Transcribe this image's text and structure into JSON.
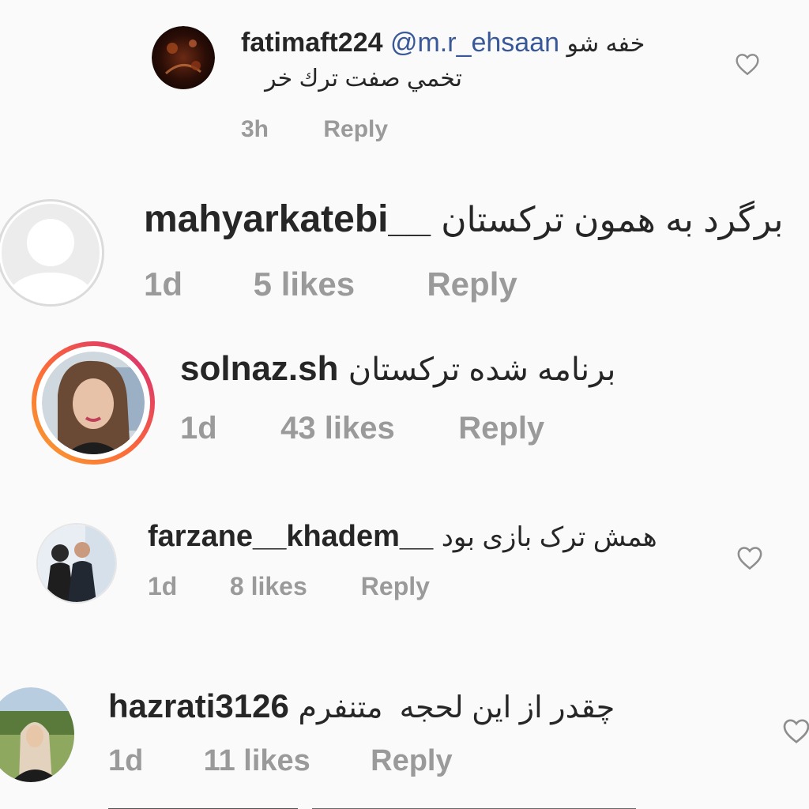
{
  "comments": [
    {
      "username": "fatimaft224",
      "mention": "@m.r_ehsaan",
      "text_line1": "خفه شو",
      "text_line2": "تخمي صفت ترك خر",
      "time": "3h",
      "likes": "",
      "reply": "Reply"
    },
    {
      "username": "mahyarkatebi__",
      "text": "برگرد به همون ترکستان",
      "time": "1d",
      "likes": "5 likes",
      "reply": "Reply"
    },
    {
      "username": "solnaz.sh",
      "text": "برنامه شده ترکستان",
      "time": "1d",
      "likes": "43 likes",
      "reply": "Reply"
    },
    {
      "username": "farzane__khadem__",
      "text": "همش ترک بازی بود",
      "time": "1d",
      "likes": "8 likes",
      "reply": "Reply"
    },
    {
      "username": "hazrati3126",
      "text": "چقدر از این لحجه  متنفرم",
      "time": "1d",
      "likes": "11 likes",
      "reply": "Reply"
    }
  ],
  "colors": {
    "username": "#262626",
    "mention": "#385898",
    "meta": "#9a9a9a",
    "story_ring_start": "#f9a12e",
    "story_ring_end": "#d62976"
  },
  "icons": {
    "like": "heart-outline-icon",
    "default_avatar": "person-silhouette-icon"
  }
}
